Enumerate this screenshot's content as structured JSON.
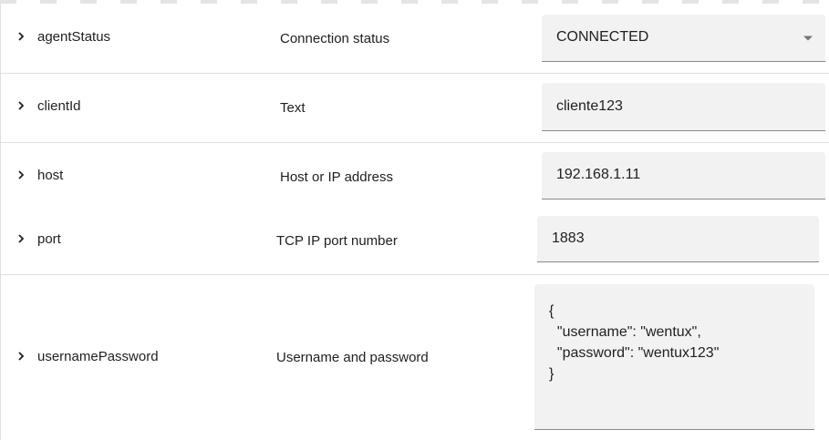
{
  "properties": [
    {
      "name": "agentStatus",
      "description": "Connection status",
      "value": "CONNECTED",
      "control": "select"
    },
    {
      "name": "clientId",
      "description": "Text",
      "value": "cliente123",
      "control": "text"
    },
    {
      "name": "host",
      "description": "Host or IP address",
      "value": "192.168.1.11",
      "control": "text"
    },
    {
      "name": "port",
      "description": "TCP IP port number",
      "value": "1883",
      "control": "text"
    },
    {
      "name": "usernamePassword",
      "description": "Username and password",
      "value": "{\n  \"username\": \"wentux\",\n  \"password\": \"wentux123\"\n}",
      "control": "textarea"
    }
  ],
  "icons": {
    "expand": "chevron-right-icon",
    "dropdown": "caret-down-icon"
  },
  "colors": {
    "field_bg": "#f2f2f2",
    "divider": "#e0e0e0",
    "field_underline": "#8a8a8a"
  }
}
